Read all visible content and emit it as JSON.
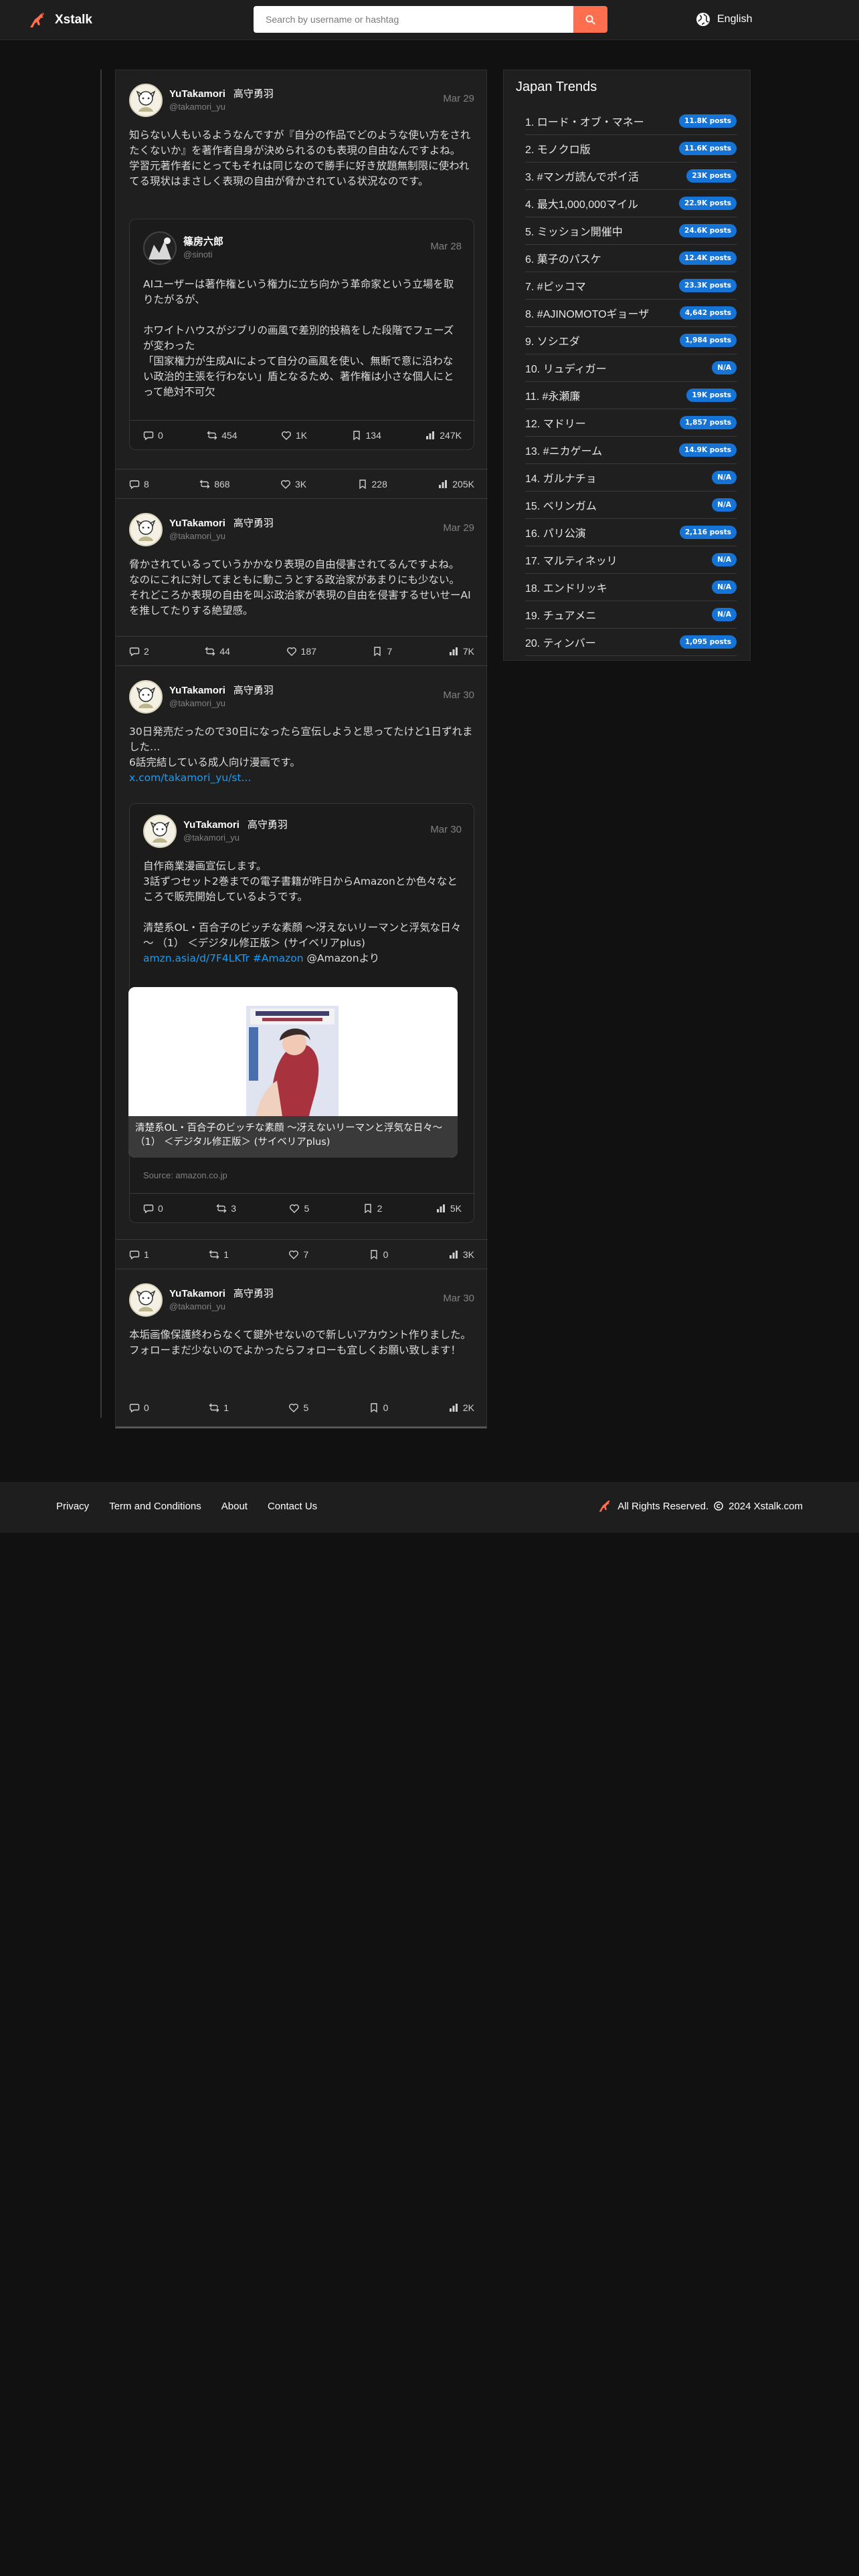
{
  "brand": {
    "name": "Xstalk",
    "color": "#ff6f4f"
  },
  "search": {
    "placeholder": "Search by username or hashtag"
  },
  "language": {
    "label": "English"
  },
  "posts": [
    {
      "name": "YuTakamori",
      "real_name": "高守勇羽",
      "handle": "@takamori_yu",
      "date": "Mar 29",
      "text": "知らない人もいるようなんですが『自分の作品でどのような使い方をされたくないか』を著作者自身が決められるのも表現の自由なんですよね。\n学習元著作者にとってもそれは同じなので勝手に好き放題無制限に使われてる現状はまさしく表現の自由が脅かされている状況なのです。",
      "quote": {
        "name": "篠房六郎",
        "handle": "@sinoti",
        "date": "Mar 28",
        "text": "AIユーザーは著作権という権力に立ち向かう革命家という立場を取りたがるが、\n\nホワイトハウスがジブリの画風で差別的投稿をした段階でフェーズが変わった\n「国家権力が生成AIによって自分の画風を使い、無断で意に沿わない政治的主張を行わない」盾となるため、著作権は小さな個人にとって絶対不可欠",
        "replies": "0",
        "retweets": "454",
        "likes": "1K",
        "bookmarks": "134",
        "views": "247K"
      },
      "replies": "8",
      "retweets": "868",
      "likes": "3K",
      "bookmarks": "228",
      "views": "205K"
    },
    {
      "name": "YuTakamori",
      "real_name": "高守勇羽",
      "handle": "@takamori_yu",
      "date": "Mar 29",
      "text": "脅かされているっていうかかなり表現の自由侵害されてるんですよね。\nなのにこれに対してまともに動こうとする政治家があまりにも少ない。\nそれどころか表現の自由を叫ぶ政治家が表現の自由を侵害するせいせーAIを推してたりする絶望感。",
      "replies": "2",
      "retweets": "44",
      "likes": "187",
      "bookmarks": "7",
      "views": "7K"
    },
    {
      "name": "YuTakamori",
      "real_name": "高守勇羽",
      "handle": "@takamori_yu",
      "date": "Mar 30",
      "text": "30日発売だったので30日になったら宣伝しようと思ってたけど1日ずれました…\n6話完結している成人向け漫画です。",
      "link": "x.com/takamori_yu/st...",
      "quote": {
        "name": "YuTakamori",
        "real_name": "高守勇羽",
        "handle": "@takamori_yu",
        "date": "Mar 30",
        "text": "自作商業漫画宣伝します。\n3話ずつセット2巻までの電子書籍が昨日からAmazonとか色々なところで販売開始しているようです。\n\n清楚系OL・百合子のビッチな素顔 ～冴えないリーマンと浮気な日々～ （1） ＜デジタル修正版＞ (サイベリアplus)",
        "link": "amzn.asia/d/7F4LKTr",
        "hashtag": "#Amazon",
        "after": " @Amazonより",
        "card_title": "清楚系OL・百合子のビッチな素顔 ～冴えないリーマンと浮気な日々～ （1） ＜デジタル修正版＞ (サイベリアplus)",
        "source": "Source: amazon.co.jp",
        "replies": "0",
        "retweets": "3",
        "likes": "5",
        "bookmarks": "2",
        "views": "5K"
      },
      "replies": "1",
      "retweets": "1",
      "likes": "7",
      "bookmarks": "0",
      "views": "3K"
    },
    {
      "name": "YuTakamori",
      "real_name": "高守勇羽",
      "handle": "@takamori_yu",
      "date": "Mar 30",
      "text": "本垢画像保護終わらなくて鍵外せないので新しいアカウント作りました。\nフォローまだ少ないのでよかったらフォローも宜しくお願い致します！",
      "replies": "0",
      "retweets": "1",
      "likes": "5",
      "bookmarks": "0",
      "views": "2K"
    }
  ],
  "trends": {
    "title": "Japan Trends",
    "items": [
      {
        "label": "1. ロード・オブ・マネー",
        "count": "11.8K posts"
      },
      {
        "label": "2. モノクロ版",
        "count": "11.6K posts"
      },
      {
        "label": "3. #マンガ読んでポイ活",
        "count": "23K posts"
      },
      {
        "label": "4. 最大1,000,000マイル",
        "count": "22.9K posts"
      },
      {
        "label": "5. ミッション開催中",
        "count": "24.6K posts"
      },
      {
        "label": "6. 菓子のパスケ",
        "count": "12.4K posts"
      },
      {
        "label": "7. #ピッコマ",
        "count": "23.3K posts"
      },
      {
        "label": "8. #AJINOMOTOギョーザ",
        "count": "4,642 posts"
      },
      {
        "label": "9. ソシエダ",
        "count": "1,984 posts"
      },
      {
        "label": "10. リュディガー",
        "count": "N/A"
      },
      {
        "label": "11. #永瀬廉",
        "count": "19K posts"
      },
      {
        "label": "12. マドリー",
        "count": "1,857 posts"
      },
      {
        "label": "13. #ニカゲーム",
        "count": "14.9K posts"
      },
      {
        "label": "14. ガルナチョ",
        "count": "N/A"
      },
      {
        "label": "15. ベリンガム",
        "count": "N/A"
      },
      {
        "label": "16. パリ公演",
        "count": "2,116 posts"
      },
      {
        "label": "17. マルティネッリ",
        "count": "N/A"
      },
      {
        "label": "18. エンドリッキ",
        "count": "N/A"
      },
      {
        "label": "19. チュアメニ",
        "count": "N/A"
      },
      {
        "label": "20. ティンバー",
        "count": "1,095 posts"
      }
    ]
  },
  "footer": {
    "links": [
      "Privacy",
      "Term and Conditions",
      "About",
      "Contact Us"
    ],
    "rights": "All Rights Reserved.",
    "copyright": "2024 Xstalk.com"
  },
  "colors": {
    "accent": "#ff6f4f",
    "badge": "#1674d6",
    "link": "#1d9bf0"
  }
}
